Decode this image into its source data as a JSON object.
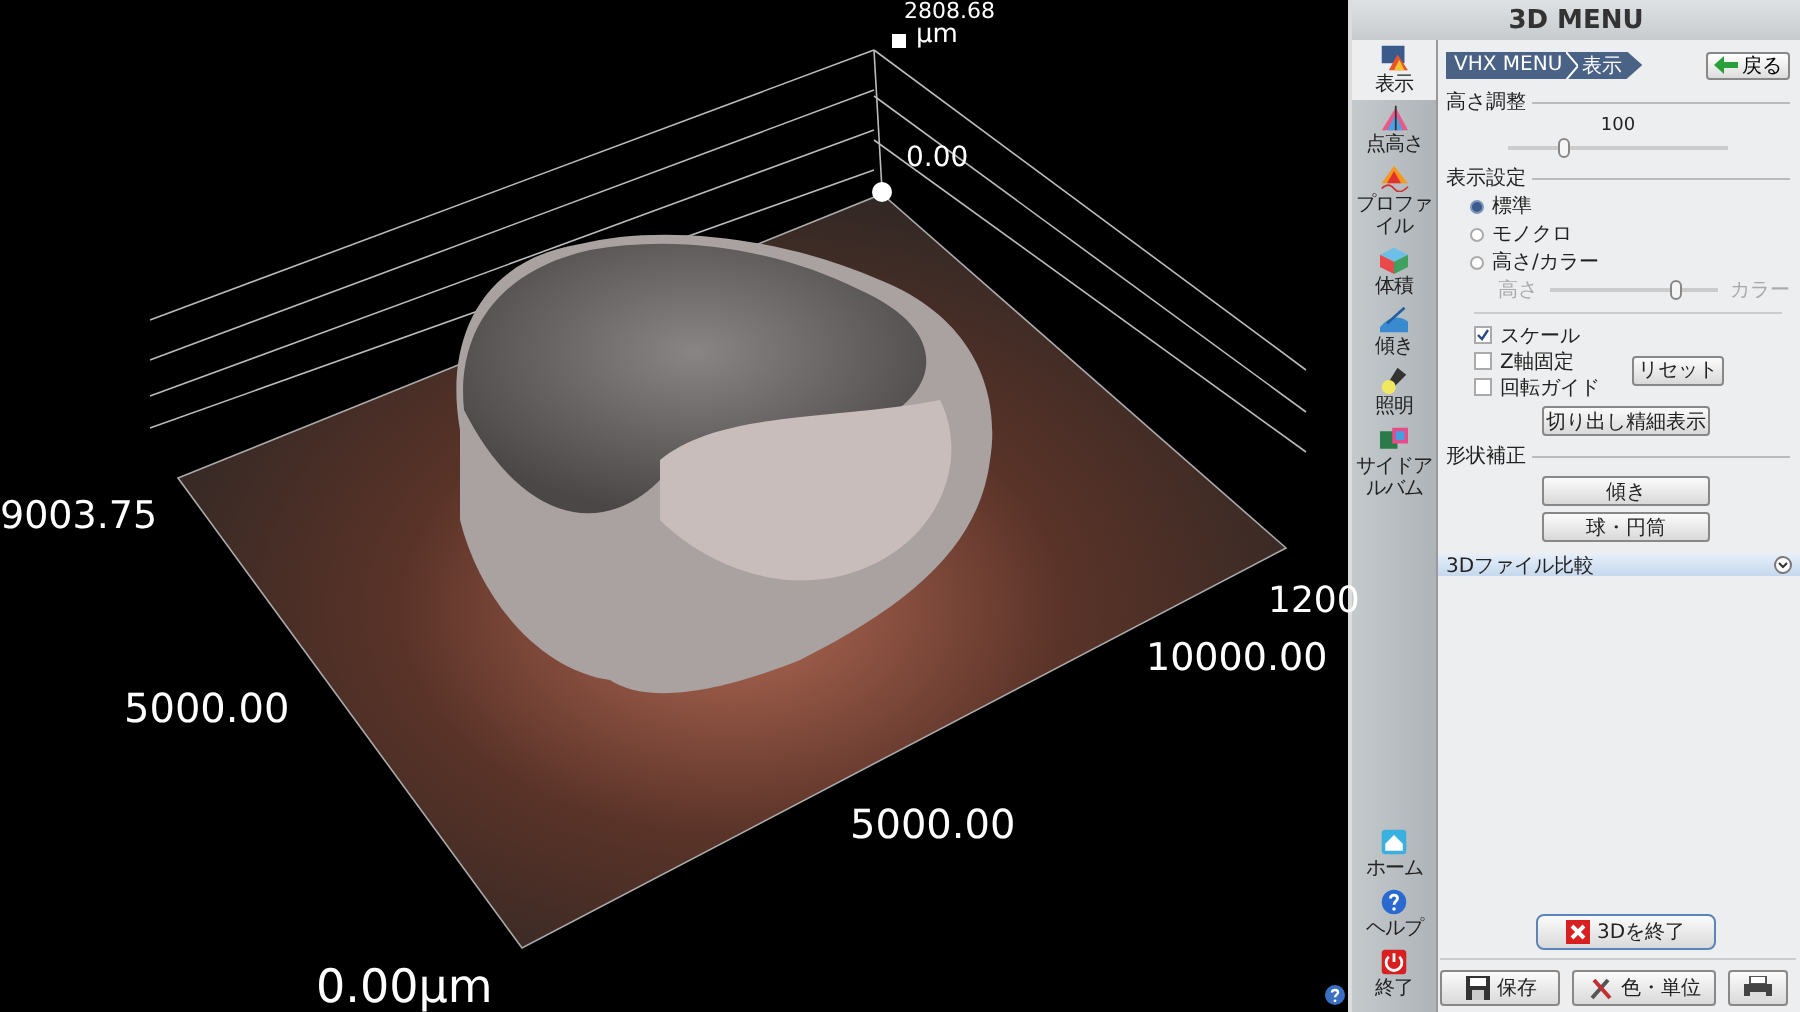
{
  "window": {
    "title": "3D MENU"
  },
  "viewer": {
    "axis_labels": {
      "z_max": "2808.68",
      "z_unit": "µm",
      "z_min": "0.00",
      "y_max": "9003.75",
      "y_mid": "5000.00",
      "origin": "0.00µm",
      "right_max": "1200",
      "right_far": "10000.00",
      "front_mid": "5000.00"
    }
  },
  "sidebar": {
    "items": [
      {
        "label": "表示",
        "selected": true
      },
      {
        "label": "点高さ",
        "selected": false
      },
      {
        "label": "プロファイル",
        "selected": false
      },
      {
        "label": "体積",
        "selected": false
      },
      {
        "label": "傾き",
        "selected": false
      },
      {
        "label": "照明",
        "selected": false
      },
      {
        "label": "サイドアルバム",
        "selected": false
      }
    ],
    "bottom_items": [
      {
        "label": "ホーム"
      },
      {
        "label": "ヘルプ"
      },
      {
        "label": "終了"
      }
    ]
  },
  "breadcrumb": [
    "VHX MENU",
    "表示"
  ],
  "back_button": "戻る",
  "height_adjust": {
    "heading": "高さ調整",
    "value": "100",
    "level": 0.25
  },
  "display_settings": {
    "heading": "表示設定",
    "modes": [
      {
        "label": "標準",
        "selected": true
      },
      {
        "label": "モノクロ",
        "selected": false
      },
      {
        "label": "高さ/カラー",
        "selected": false
      }
    ],
    "blend": {
      "left": "高さ",
      "right": "カラー",
      "level": 0.75,
      "disabled": true
    },
    "options": [
      {
        "label": "スケール",
        "checked": true
      },
      {
        "label": "Z軸固定",
        "checked": false
      },
      {
        "label": "回転ガイド",
        "checked": false
      }
    ],
    "reset_button": "リセット",
    "detail_button": "切り出し精細表示"
  },
  "shape_correction": {
    "heading": "形状補正",
    "buttons": [
      "傾き",
      "球・円筒"
    ]
  },
  "compare_bar": {
    "label": "3Dファイル比較",
    "expanded": false
  },
  "exit_button": "3Dを終了",
  "footer_buttons": [
    "保存",
    "色・単位"
  ]
}
